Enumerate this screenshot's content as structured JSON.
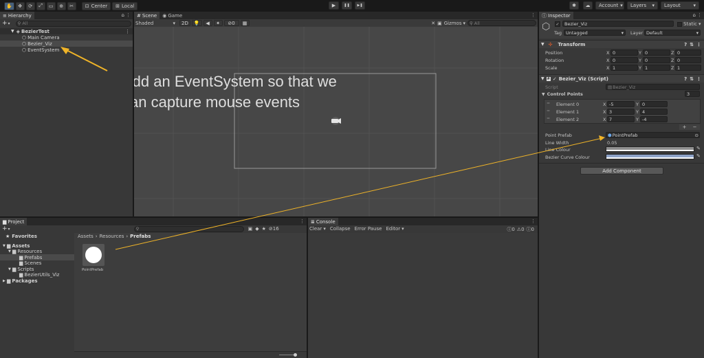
{
  "toolbar": {
    "tools": [
      "✋",
      "✥",
      "⟳",
      "⤢",
      "▭",
      "⊕",
      "✂"
    ],
    "pivot": "Center",
    "space": "Local",
    "play": "▶",
    "pause": "❚❚",
    "step": "▶❚",
    "account": "Account",
    "layers": "Layers",
    "layout": "Layout"
  },
  "hierarchy": {
    "tab": "Hierarchy",
    "search_placeholder": "All",
    "scene": "BezierTest",
    "items": [
      "Main Camera",
      "Bezier_Viz",
      "EventSystem"
    ]
  },
  "scene_view": {
    "tab_scene": "Scene",
    "tab_game": "Game",
    "shading": "Shaded",
    "mode_2d": "2D",
    "gizmos": "Gizmos",
    "search_placeholder": "All",
    "fx_count": "0"
  },
  "annotation": {
    "line1": "Add an EventSystem so that we",
    "line2": "can capture mouse events"
  },
  "inspector": {
    "tab": "Inspector",
    "object_name": "Bezier_Viz",
    "static": "Static",
    "tag_label": "Tag",
    "tag_value": "Untagged",
    "layer_label": "Layer",
    "layer_value": "Default",
    "transform": {
      "title": "Transform",
      "rows": [
        {
          "label": "Position",
          "x": "0",
          "y": "0",
          "z": "0"
        },
        {
          "label": "Rotation",
          "x": "0",
          "y": "0",
          "z": "0"
        },
        {
          "label": "Scale",
          "x": "1",
          "y": "1",
          "z": "1"
        }
      ]
    },
    "script": {
      "title": "Bezier_Viz (Script)",
      "script_label": "Script",
      "script_value": "Bezier_Viz",
      "control_points_label": "Control Points",
      "control_points_count": "3",
      "elements": [
        {
          "label": "Element 0",
          "x": "-5",
          "y": "0"
        },
        {
          "label": "Element 1",
          "x": "3",
          "y": "4"
        },
        {
          "label": "Element 2",
          "x": "7",
          "y": "-4"
        }
      ],
      "point_prefab_label": "Point Prefab",
      "point_prefab_value": "PointPrefab",
      "line_width_label": "Line Width",
      "line_width_value": "0.05",
      "line_colour_label": "Line Colour",
      "curve_colour_label": "Bezier Curve Colour",
      "line_colour": "#8f8f8f",
      "curve_colour": "#8ea3c8"
    },
    "add_component": "Add Component"
  },
  "project": {
    "tab": "Project",
    "favorites": "Favorites",
    "tree": [
      {
        "label": "Assets",
        "bold": true
      },
      {
        "label": "Resources",
        "bold": false
      },
      {
        "label": "Prefabs",
        "bold": false
      },
      {
        "label": "Scenes",
        "bold": false
      },
      {
        "label": "Scripts",
        "bold": false
      },
      {
        "label": "BezierUtils_Viz",
        "bold": false
      },
      {
        "label": "Packages",
        "bold": true
      }
    ],
    "breadcrumb": [
      "Assets",
      "Resources",
      "Prefabs"
    ],
    "asset_name": "PointPrefab",
    "hidden_count": "16"
  },
  "console": {
    "tab": "Console",
    "clear": "Clear",
    "collapse": "Collapse",
    "error_pause": "Error Pause",
    "editor": "Editor",
    "errors": "0",
    "warnings": "0",
    "logs": "0"
  },
  "colors": {
    "arrow": "#f0b428",
    "selection": "#46607c"
  }
}
